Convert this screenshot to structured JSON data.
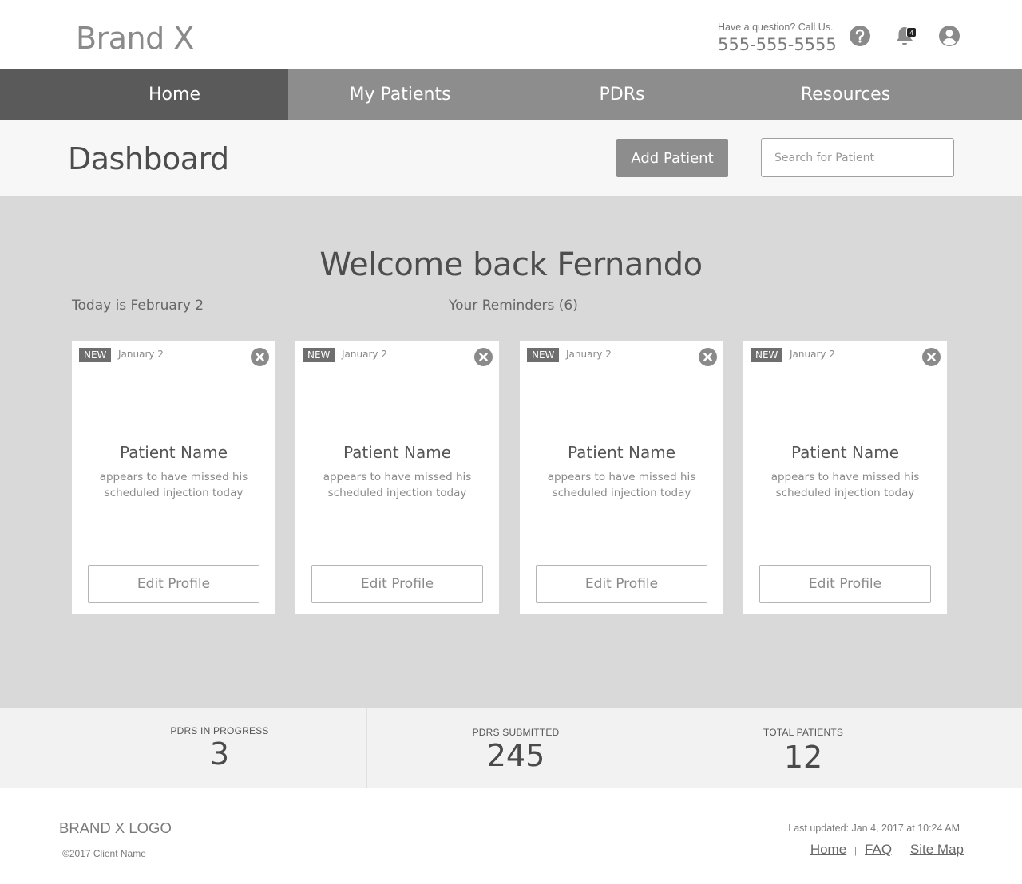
{
  "header": {
    "brand": "Brand X",
    "contact_question": "Have a question? Call Us.",
    "contact_phone": "555-555-5555",
    "icons": [
      "help-icon",
      "bell-icon",
      "user-icon"
    ],
    "notification_count": "4"
  },
  "nav": {
    "items": [
      {
        "label": "Home",
        "active": true
      },
      {
        "label": "My Patients",
        "active": false
      },
      {
        "label": "PDRs",
        "active": false
      },
      {
        "label": "Resources",
        "active": false
      }
    ]
  },
  "subheader": {
    "title": "Dashboard",
    "add_patient_label": "Add Patient",
    "search_placeholder": "Search for Patient"
  },
  "main": {
    "welcome": "Welcome back Fernando",
    "today": "Today is February 2",
    "reminders_label": "Your Reminders (6)",
    "cards": [
      {
        "badge": "NEW",
        "date": "January 2",
        "name": "Patient Name",
        "message": "appears to have missed his scheduled injection today",
        "button": "Edit Profile"
      },
      {
        "badge": "NEW",
        "date": "January 2",
        "name": "Patient Name",
        "message": "appears to have missed his scheduled injection today",
        "button": "Edit Profile"
      },
      {
        "badge": "NEW",
        "date": "January 2",
        "name": "Patient Name",
        "message": "appears to have missed his scheduled injection today",
        "button": "Edit Profile"
      },
      {
        "badge": "NEW",
        "date": "January 2",
        "name": "Patient Name",
        "message": "appears to have missed his scheduled injection today",
        "button": "Edit Profile"
      }
    ]
  },
  "stats": [
    {
      "label": "PDRS IN PROGRESS",
      "value": "3"
    },
    {
      "label": "PDRS SUBMITTED",
      "value": "245"
    },
    {
      "label": "TOTAL PATIENTS",
      "value": "12"
    }
  ],
  "footer": {
    "logo": "BRAND X LOGO",
    "copyright": "©2017 Client Name",
    "last_updated": "Last updated: Jan 4, 2017 at 10:24 AM",
    "links": [
      "Home",
      "FAQ",
      "Site Map"
    ],
    "separator": "|"
  },
  "colors": {
    "nav_bg": "#8d8d8d",
    "nav_active": "#5a5a5a",
    "main_bg": "#d9d9d9",
    "button_bg": "#8d8d8d"
  }
}
